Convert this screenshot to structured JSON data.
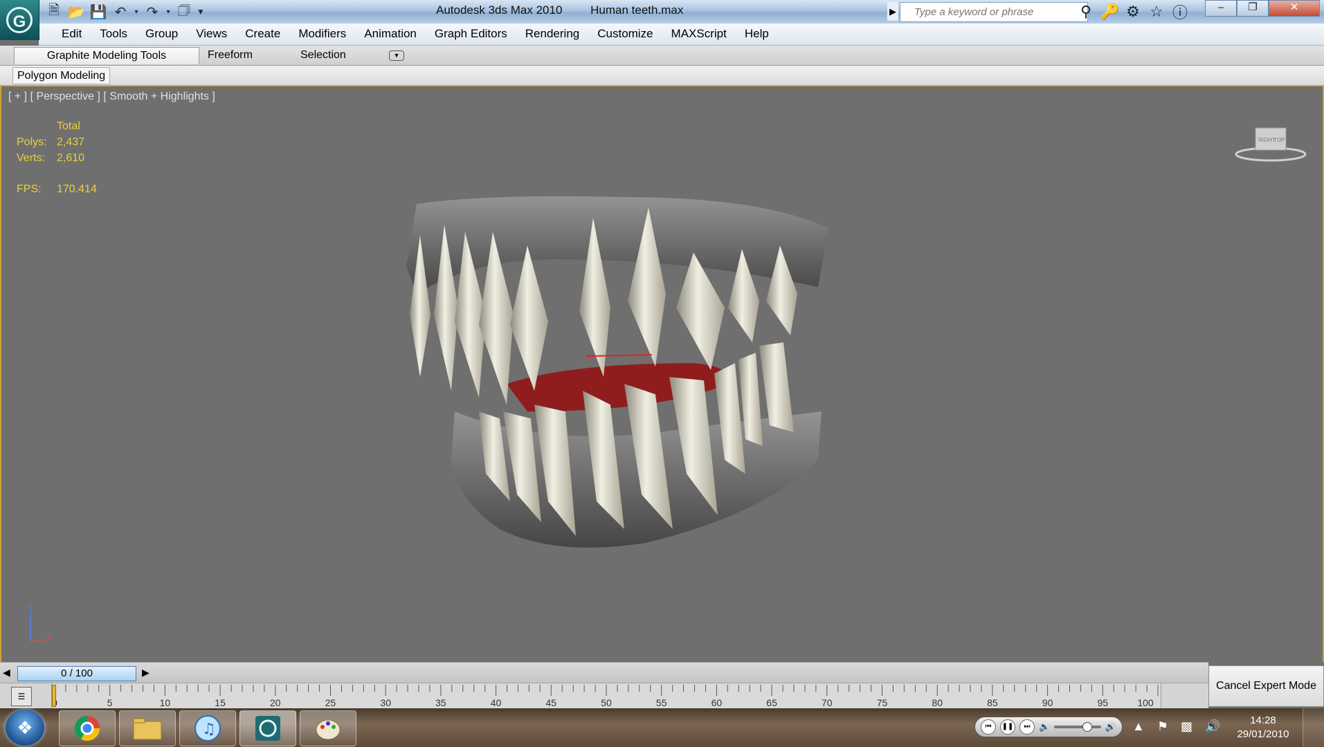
{
  "window": {
    "app_name": "Autodesk 3ds Max  2010",
    "file_name": "Human teeth.max",
    "search_placeholder": "Type a keyword or phrase"
  },
  "menu": [
    "Edit",
    "Tools",
    "Group",
    "Views",
    "Create",
    "Modifiers",
    "Animation",
    "Graph Editors",
    "Rendering",
    "Customize",
    "MAXScript",
    "Help"
  ],
  "ribbon": {
    "tabs": [
      "Graphite Modeling Tools",
      "Freeform",
      "Selection"
    ],
    "panel": "Polygon Modeling"
  },
  "viewport": {
    "label": "[ + ] [ Perspective ] [ Smooth + Highlights ]",
    "stats": {
      "header": "Total",
      "polys_label": "Polys:",
      "polys_value": "2,437",
      "verts_label": "Verts:",
      "verts_value": "2,610",
      "fps_label": "FPS:",
      "fps_value": "170.414"
    },
    "viewcube": {
      "right": "RIGHT",
      "top": "TOP"
    },
    "axes": {
      "z": "z",
      "x": "x"
    }
  },
  "timeline": {
    "frame_display": "0 / 100",
    "ruler_labels": [
      "0",
      "5",
      "10",
      "15",
      "20",
      "25",
      "30",
      "35",
      "40",
      "45",
      "50",
      "55",
      "60",
      "65",
      "70",
      "75",
      "80",
      "85",
      "90",
      "95",
      "100"
    ],
    "cancel_expert": "Cancel Expert Mode"
  },
  "taskbar": {
    "time": "14:28",
    "date": "29/01/2010"
  },
  "colors": {
    "stats_text": "#e8d23a",
    "viewport_bg": "#6f6f6f",
    "active_border": "#c9a53a",
    "gum": "#8f1d1d"
  }
}
